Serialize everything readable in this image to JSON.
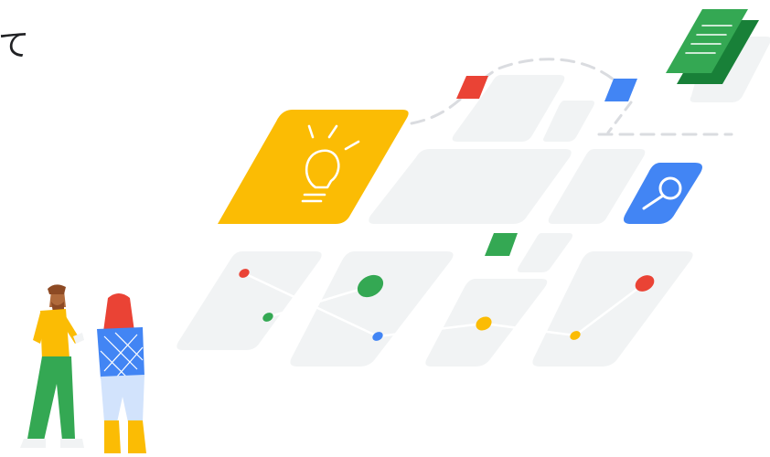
{
  "page": {
    "heading_fragment": "て"
  },
  "colors": {
    "yellow": "#FBBC04",
    "blue": "#4285F4",
    "green": "#34A853",
    "red": "#EA4335",
    "tile_gray": "#F1F3F4",
    "dash_gray": "#DADCE0",
    "text": "#202124"
  },
  "icons": [
    "lightbulb-icon",
    "magnifier-icon",
    "document-stack-icon"
  ]
}
